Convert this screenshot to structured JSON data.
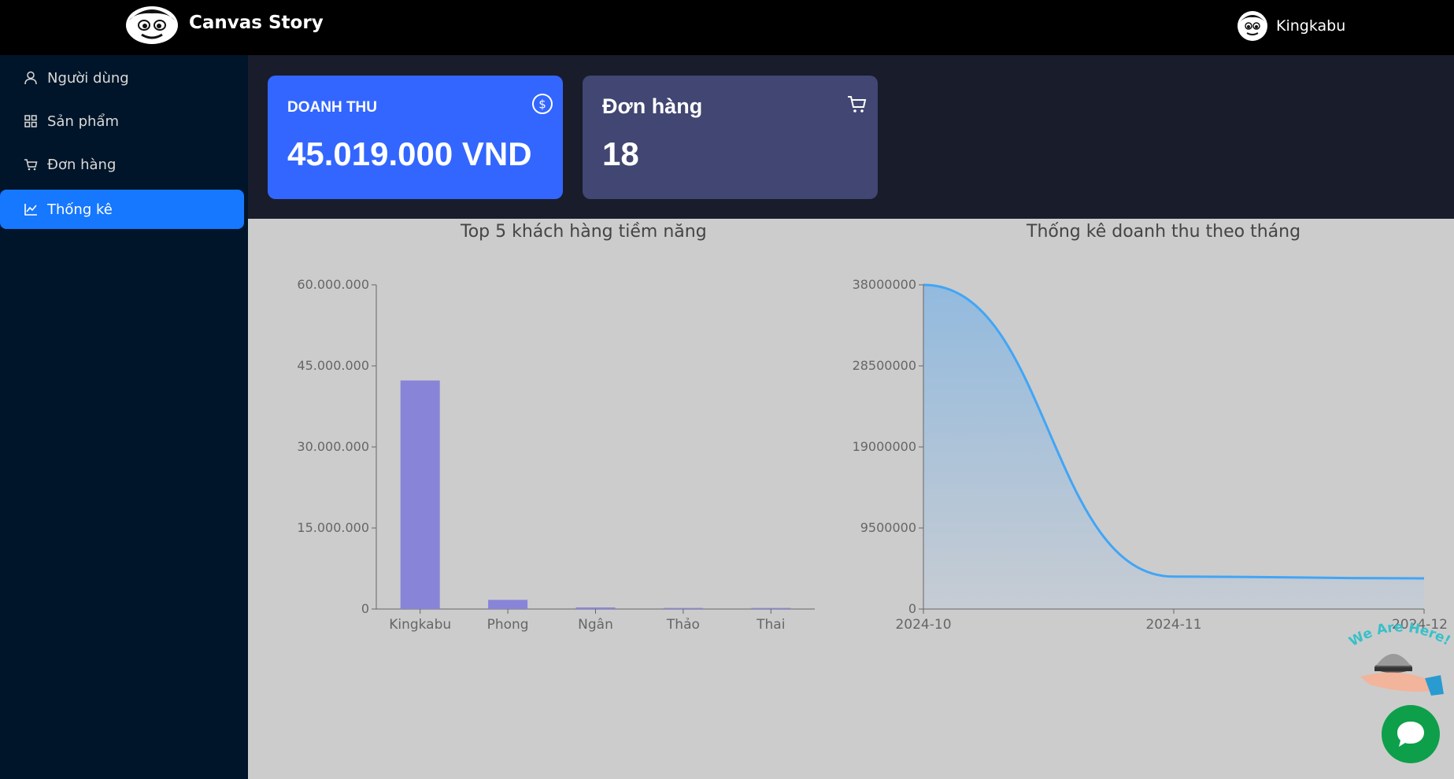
{
  "header": {
    "brand": "Canvas Story",
    "user_name": "Kingkabu"
  },
  "sidebar": {
    "items": [
      {
        "label": "Người dùng",
        "icon": "user-icon"
      },
      {
        "label": "Sản phẩm",
        "icon": "grid-icon"
      },
      {
        "label": "Đơn hàng",
        "icon": "cart-icon"
      },
      {
        "label": "Thống kê",
        "icon": "line-chart-icon",
        "active": true
      }
    ]
  },
  "stats": {
    "revenue": {
      "label": "DOANH THU",
      "value": "45.019.000 VND",
      "icon": "dollar-circle-icon",
      "color": "#3366ff"
    },
    "orders": {
      "label": "Đơn hàng",
      "value": "18",
      "icon": "cart-icon",
      "color": "#414672"
    }
  },
  "chart_data": [
    {
      "type": "bar",
      "title": "Top 5 khách hàng tiềm năng",
      "categories": [
        "Kingkabu",
        "Phong",
        "Ngân",
        "Thảo",
        "Thai"
      ],
      "values": [
        42300000,
        1700000,
        300000,
        200000,
        200000
      ],
      "yticks": [
        "0",
        "15.000.000",
        "30.000.000",
        "45.000.000",
        "60.000.000"
      ],
      "ylim": [
        0,
        60000000
      ],
      "color": "#8884d8"
    },
    {
      "type": "area",
      "title": "Thống kê doanh thu theo tháng",
      "categories": [
        "2024-10",
        "2024-11",
        "2024-12"
      ],
      "values": [
        38000000,
        3800000,
        3600000
      ],
      "yticks": [
        "0",
        "9500000",
        "19000000",
        "28500000",
        "38000000"
      ],
      "ylim": [
        0,
        38000000
      ],
      "color": "#42a5f5"
    }
  ],
  "widget": {
    "text": "We Are Here!"
  }
}
